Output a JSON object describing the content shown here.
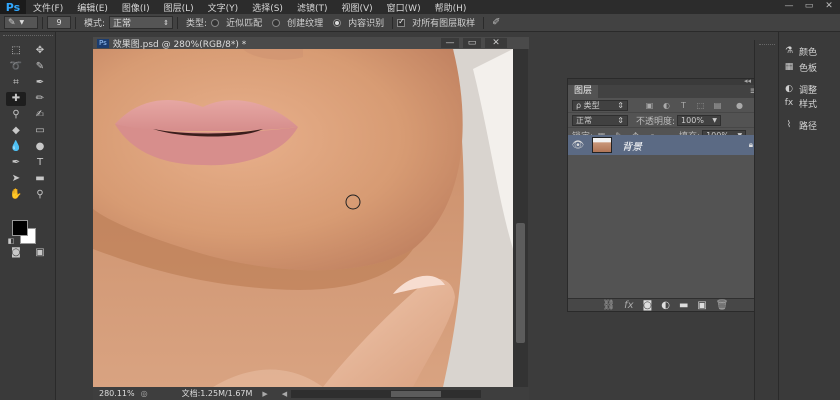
{
  "app": {
    "logo": "Ps"
  },
  "menu": [
    "文件(F)",
    "编辑(E)",
    "图像(I)",
    "图层(L)",
    "文字(Y)",
    "选择(S)",
    "滤镜(T)",
    "视图(V)",
    "窗口(W)",
    "帮助(H)"
  ],
  "window_controls": {
    "minimize": "—",
    "maximize": "▭",
    "close": "✕"
  },
  "options": {
    "brush_size": "9",
    "mode_label": "模式:",
    "mode_value": "正常",
    "type_label": "类型:",
    "type_options": [
      "近似匹配",
      "创建纹理",
      "内容识别"
    ],
    "type_selected": "内容识别",
    "sample_all_label": "对所有图层取样",
    "sample_all_checked": true
  },
  "document": {
    "tab_title": "效果图.psd @ 280%(RGB/8*) *",
    "tab_ps_badge": "Ps",
    "zoom": "280.11%",
    "doc_info": "文档:1.25M/1.67M",
    "colors": {
      "foreground": "#000000",
      "background": "#ffffff"
    }
  },
  "layers_panel": {
    "tab_label": "图层",
    "filter_label": "ρ 类型",
    "blend_mode": "正常",
    "opacity_label": "不透明度:",
    "opacity_value": "100%",
    "lock_label": "锁定:",
    "fill_label": "填充:",
    "fill_value": "100%",
    "layer_name": "背景",
    "visible_icon": "eye-icon",
    "lock_icon": "lock-icon"
  },
  "right_dock": {
    "items": [
      {
        "label": "颜色",
        "icon": "color-icon"
      },
      {
        "label": "色板",
        "icon": "swatches-icon"
      },
      {
        "label": "调整",
        "icon": "adjustments-icon"
      },
      {
        "label": "样式",
        "icon": "styles-icon"
      },
      {
        "label": "路径",
        "icon": "paths-icon"
      }
    ]
  }
}
